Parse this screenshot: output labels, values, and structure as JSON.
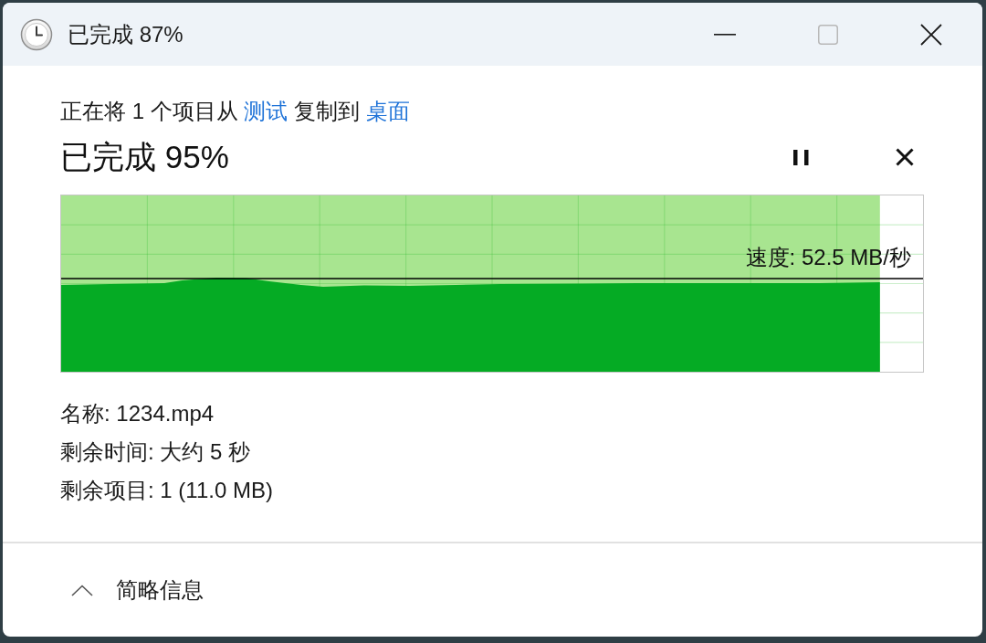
{
  "window": {
    "title": "已完成 87%",
    "controls": [
      {
        "kind": "minimize",
        "disabled": false
      },
      {
        "kind": "maximize",
        "disabled": true
      },
      {
        "kind": "close",
        "disabled": false
      }
    ]
  },
  "copy_line": [
    {
      "kind": "text",
      "text": "正在将 1 个项目从"
    },
    {
      "kind": "link",
      "text": "测试"
    },
    {
      "kind": "text",
      "text": "复制到"
    },
    {
      "kind": "link",
      "text": "桌面"
    }
  ],
  "progress": {
    "heading": "已完成 95%",
    "level": 0.95,
    "speed": "速度: 52.5 MB/秒"
  },
  "details": [
    "名称: 1234.mp4",
    "剩余时间: 大约 5 秒",
    "剩余项目: 1 (11.0 MB)"
  ],
  "footer": {
    "toggle": {
      "label": "简略信息",
      "expanded": true
    }
  }
}
